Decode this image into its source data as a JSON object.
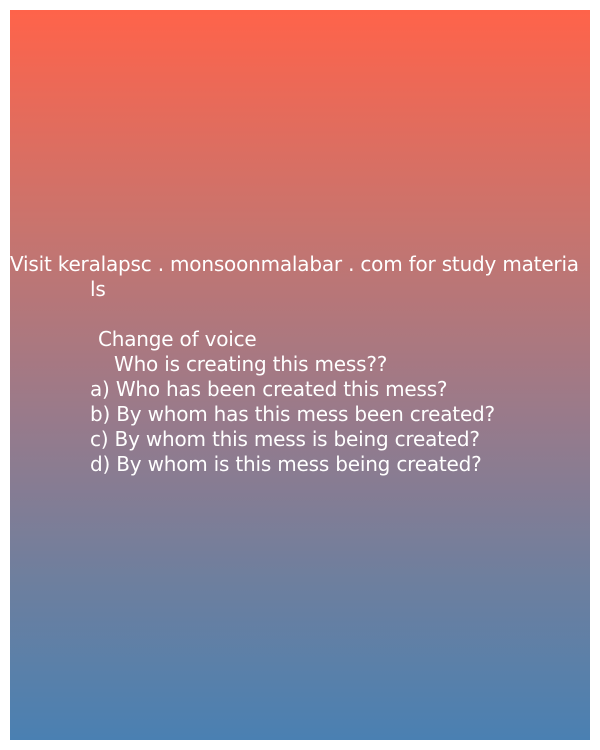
{
  "header": {
    "line1": "Visit keralapsc . monsoonmalabar . com for study materia",
    "line2": "ls"
  },
  "quiz": {
    "title": "Change of voice",
    "question": "Who is creating this mess??",
    "options": [
      "a) Who has been created this mess?",
      "b) By whom has this mess been created?",
      "c) By whom this mess is being created?",
      "d) By whom is this mess being created?"
    ]
  },
  "colors": {
    "gradient_top": "#ff634a",
    "gradient_bottom": "#4a80b2",
    "text": "#ffffff"
  }
}
